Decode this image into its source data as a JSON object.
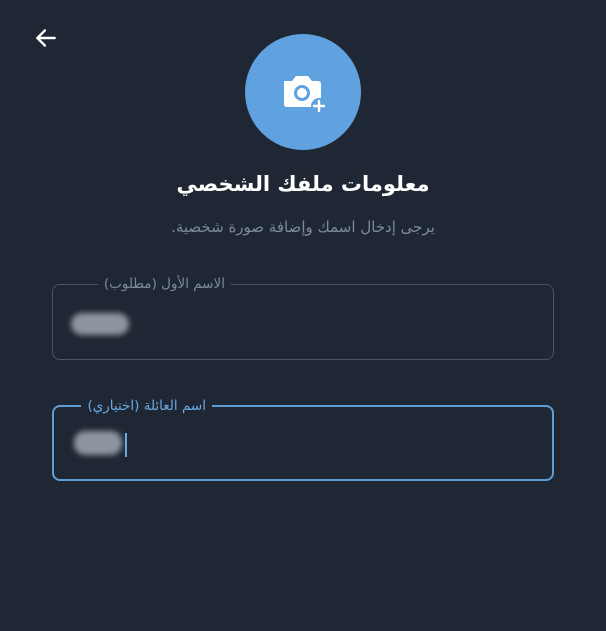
{
  "header": {
    "back_icon": "arrow-left-icon",
    "avatar_icon": "add-photo-camera-icon",
    "avatar_color": "#5fa2df"
  },
  "profile": {
    "title": "معلومات ملفك الشخصي",
    "subtitle": "يرجى إدخال اسمك وإضافة صورة شخصية."
  },
  "form": {
    "first_name": {
      "label": "الاسم الأول (مطلوب)",
      "value_redacted": true
    },
    "last_name": {
      "label": "اسم العائلة (اختياري)",
      "value_redacted": true,
      "focused": true
    }
  },
  "colors": {
    "background": "#1e2733",
    "accent": "#5d9ed8",
    "muted_text": "#7d8b99"
  }
}
